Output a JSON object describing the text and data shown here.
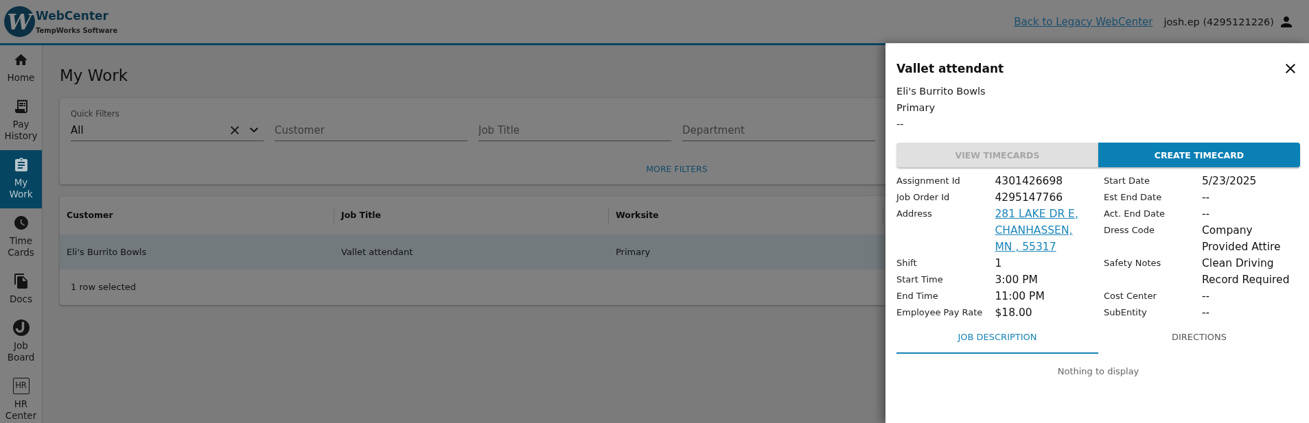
{
  "header": {
    "logo": {
      "mark": "W",
      "name": "WebCenter",
      "tagline": "TempWorks Software"
    },
    "legacy_link": "Back to Legacy WebCenter",
    "user": "josh.ep (4295121226)"
  },
  "sidebar": {
    "items": [
      {
        "label": "Home",
        "selected": false
      },
      {
        "label": "Pay History",
        "selected": false
      },
      {
        "label": "My Work",
        "selected": true
      },
      {
        "label": "Time Cards",
        "selected": false
      },
      {
        "label": "Docs",
        "selected": false
      },
      {
        "label": "Job Board",
        "selected": false
      },
      {
        "label": "HR Center",
        "icon_text": "HR",
        "selected": false
      }
    ]
  },
  "page": {
    "title": "My Work"
  },
  "filters": {
    "fields": [
      {
        "kind": "select",
        "label": "Quick Filters",
        "value": "All"
      },
      {
        "kind": "text",
        "placeholder": "Customer"
      },
      {
        "kind": "text",
        "placeholder": "Job Title"
      },
      {
        "kind": "text",
        "placeholder": "Department"
      }
    ],
    "more_button": "MORE FILTERS"
  },
  "table": {
    "columns": [
      "Customer",
      "Job Title",
      "Worksite"
    ],
    "rows": [
      {
        "cells": [
          "Eli's Burrito Bowls",
          "Vallet attendant",
          "Primary"
        ],
        "selected": true
      }
    ],
    "footer": "1 row selected"
  },
  "drawer": {
    "title": "Vallet attendant",
    "lines": [
      "Eli's Burrito Bowls",
      "Primary",
      "--"
    ],
    "buttons": [
      {
        "label": "VIEW TIMECARDS",
        "disabled": true
      },
      {
        "label": "CREATE TIMECARD",
        "disabled": false
      }
    ],
    "details": {
      "left": [
        {
          "label": "Assignment Id",
          "value": "4301426698",
          "kind": "text"
        },
        {
          "label": "Job Order Id",
          "value": "4295147766",
          "kind": "text"
        },
        {
          "label": "Address",
          "value": "281 LAKE DR E, CHANHASSEN, MN , 55317",
          "kind": "link"
        },
        {
          "label": "Shift",
          "value": "1",
          "kind": "text"
        },
        {
          "label": "Start Time",
          "value": "3:00 PM",
          "kind": "text"
        },
        {
          "label": "End Time",
          "value": "11:00 PM",
          "kind": "text"
        },
        {
          "label": "Employee Pay Rate",
          "value": "$18.00",
          "kind": "text"
        }
      ],
      "right": [
        {
          "label": "Start Date",
          "value": "5/23/2025",
          "kind": "text"
        },
        {
          "label": "Est End Date",
          "value": "--",
          "kind": "text"
        },
        {
          "label": "Act. End Date",
          "value": "--",
          "kind": "text"
        },
        {
          "label": "Dress Code",
          "value": "Company Provided Attire",
          "kind": "text"
        },
        {
          "label": "Safety Notes",
          "value": "Clean Driving Record Required",
          "kind": "text"
        },
        {
          "label": "Cost Center",
          "value": "--",
          "kind": "text"
        },
        {
          "label": "SubEntity",
          "value": "--",
          "kind": "text"
        }
      ]
    },
    "tabs": [
      {
        "label": "JOB DESCRIPTION",
        "selected": true
      },
      {
        "label": "DIRECTIONS",
        "selected": false
      }
    ],
    "empty_message": "Nothing to display"
  }
}
